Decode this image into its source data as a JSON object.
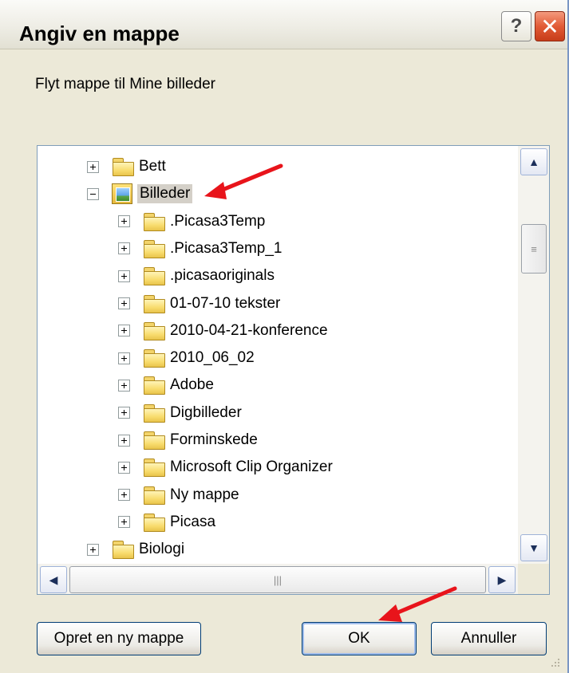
{
  "window": {
    "title": "Angiv en mappe",
    "help_label": "?",
    "close_label": "✕"
  },
  "instruction": "Flyt mappe til Mine billeder",
  "tree": {
    "items": [
      {
        "label": "Bett",
        "expander": "plus",
        "icon": "folder-icon"
      },
      {
        "label": "Billeder",
        "expander": "minus",
        "icon": "pictures-folder-icon",
        "selected": true
      },
      {
        "label": ".Picasa3Temp",
        "expander": "plus",
        "icon": "folder-icon"
      },
      {
        "label": ".Picasa3Temp_1",
        "expander": "plus",
        "icon": "folder-icon"
      },
      {
        "label": ".picasaoriginals",
        "expander": "plus",
        "icon": "folder-icon"
      },
      {
        "label": "01-07-10 tekster",
        "expander": "plus",
        "icon": "folder-icon"
      },
      {
        "label": "2010-04-21-konference",
        "expander": "plus",
        "icon": "folder-icon"
      },
      {
        "label": "2010_06_02",
        "expander": "plus",
        "icon": "folder-icon"
      },
      {
        "label": "Adobe",
        "expander": "plus",
        "icon": "folder-icon"
      },
      {
        "label": "Digbilleder",
        "expander": "plus",
        "icon": "folder-icon"
      },
      {
        "label": "Forminskede",
        "expander": "plus",
        "icon": "folder-icon"
      },
      {
        "label": "Microsoft Clip Organizer",
        "expander": "plus",
        "icon": "folder-icon"
      },
      {
        "label": "Ny mappe",
        "expander": "plus",
        "icon": "folder-icon"
      },
      {
        "label": "Picasa",
        "expander": "plus",
        "icon": "folder-icon"
      },
      {
        "label": "Biologi",
        "expander": "plus",
        "icon": "folder-icon"
      }
    ]
  },
  "scrollbar": {
    "up": "▲",
    "down": "▼",
    "left": "◀",
    "right": "▶",
    "grip": "≡",
    "hgrip": "|||"
  },
  "buttons": {
    "new_folder": "Opret en ny mappe",
    "ok": "OK",
    "cancel": "Annuller"
  },
  "colors": {
    "dialog_bg": "#ECE9D8",
    "selection_bg": "#D4D0C8",
    "annotation_arrow": "#E8141B"
  }
}
